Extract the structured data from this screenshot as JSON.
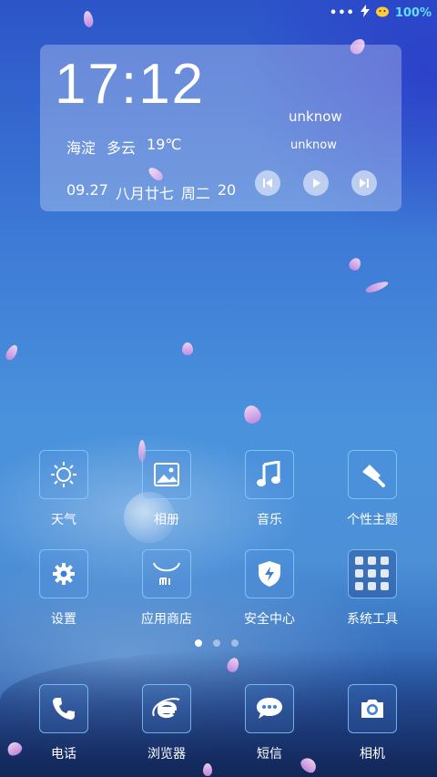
{
  "status_bar": {
    "menu": "•••",
    "battery_text": "100%"
  },
  "clock_widget": {
    "time": "17:12",
    "location": "海淀",
    "weather": "多云",
    "temperature": "19℃",
    "date": "09.27",
    "lunar": "八月廿七",
    "weekday": "周二",
    "day_suffix": "20",
    "music_title": "unknow",
    "music_artist": "unknow"
  },
  "apps": [
    {
      "label": "天气",
      "icon": "sun-icon"
    },
    {
      "label": "相册",
      "icon": "photo-icon"
    },
    {
      "label": "音乐",
      "icon": "music-note-icon"
    },
    {
      "label": "个性主题",
      "icon": "brush-icon"
    },
    {
      "label": "设置",
      "icon": "gear-icon"
    },
    {
      "label": "应用商店",
      "icon": "mi-store-icon"
    },
    {
      "label": "安全中心",
      "icon": "shield-icon"
    },
    {
      "label": "系统工具",
      "icon": "folder-grid-icon"
    }
  ],
  "dock": [
    {
      "label": "电话",
      "icon": "phone-icon"
    },
    {
      "label": "浏览器",
      "icon": "browser-e-icon"
    },
    {
      "label": "短信",
      "icon": "message-icon"
    },
    {
      "label": "相机",
      "icon": "camera-icon"
    }
  ],
  "pager": {
    "pages": 3,
    "active": 1
  },
  "colors": {
    "accent": "#5ee0ff",
    "icon_border": "#8cd2ff"
  }
}
